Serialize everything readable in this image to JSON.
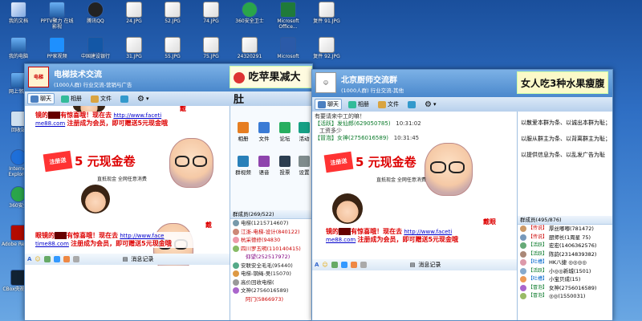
{
  "desktop": {
    "icons": [
      {
        "label": "我的文档",
        "kind": "doc"
      },
      {
        "label": "PPTV聚力 在线影视",
        "kind": "pptv"
      },
      {
        "label": "腾讯QQ",
        "kind": "qq"
      },
      {
        "label": "24.JPG",
        "kind": "img"
      },
      {
        "label": "52.JPG",
        "kind": "img"
      },
      {
        "label": "74.JPG",
        "kind": "img"
      },
      {
        "label": "360安全卫士",
        "kind": "360"
      },
      {
        "label": "Microsoft Office...",
        "kind": "xl"
      },
      {
        "label": "复件 91.JPG",
        "kind": "img"
      },
      {
        "label": "我的电脑",
        "kind": "pc"
      },
      {
        "label": "PP家视频",
        "kind": "pp"
      },
      {
        "label": "中国建设银行",
        "kind": "bank"
      },
      {
        "label": "31.JPG",
        "kind": "img"
      },
      {
        "label": "55.JPG",
        "kind": "img"
      },
      {
        "label": "75.JPG",
        "kind": "img"
      },
      {
        "label": "24320291",
        "kind": "img"
      },
      {
        "label": "Microsoft",
        "kind": "word"
      },
      {
        "label": "复件 92.JPG",
        "kind": "img"
      },
      {
        "label": "网上邻居",
        "kind": "net"
      },
      {
        "label": "回收站",
        "kind": "bin"
      },
      {
        "label": "Internet Explorer",
        "kind": "ie"
      },
      {
        "label": "360安全",
        "kind": "360"
      },
      {
        "label": "Adobe Reader",
        "kind": "pdf"
      },
      {
        "label": "CBox央视影音",
        "kind": "cbox"
      }
    ]
  },
  "left_window": {
    "title": "电梯技术交流",
    "subtitle": "(1000人群) 行业交流-营销与广告",
    "logo_text": "电梯",
    "ad_banner": "吃苹果减大肚",
    "tabs": [
      "聊天",
      "相册",
      "文件"
    ],
    "promo": {
      "top_text": "戴",
      "line1a": "镜的",
      "line1b": "有惊喜哦！现在去",
      "url1": "http://www.faceti",
      "url1b": "me88.com",
      "line1c": "注册成为会员，即可赠送5元现金哦",
      "register": "注册送",
      "cash": "5 元现金卷",
      "small": "直抵现金 全网任意消费",
      "line2a": "戴",
      "line2b": "眼镜的",
      "line2c": "有惊喜哦！现在去",
      "url2": "http://www.face",
      "url2b": "time88.com",
      "line2d": "注册成为会员，即可赠送5元现金哦"
    },
    "input_bar": {
      "history": "消息记录"
    },
    "apps": [
      {
        "label": "相册",
        "color": "#e67e22"
      },
      {
        "label": "文件",
        "color": "#3a7bd5"
      },
      {
        "label": "论坛",
        "color": "#27ae60"
      },
      {
        "label": "活动",
        "color": "#16a085"
      },
      {
        "label": "群视频",
        "color": "#2980b9"
      },
      {
        "label": "语音",
        "color": "#8e44ad"
      },
      {
        "label": "投票",
        "color": "#2c3e50"
      },
      {
        "label": "设置",
        "color": "#7f8c8d"
      }
    ],
    "members_header": "群成员(269/522)",
    "members": [
      {
        "name": "电梯(1215714607)",
        "color": "#222",
        "tag": ""
      },
      {
        "name": "江浙-电梯-设计(840122)",
        "color": "#c00",
        "tag": ""
      },
      {
        "name": "杭采德修(94830",
        "color": "#c00",
        "tag": ""
      },
      {
        "name": "四川罗五明(110140415)",
        "color": "#c00",
        "tag": ""
      },
      {
        "name": "仰望(252517972)",
        "color": "#800080",
        "tag": ""
      },
      {
        "name": "安联安全毛毛(95440)",
        "color": "#222",
        "tag": ""
      },
      {
        "name": "电梯-钢绳-吴(15070)",
        "color": "#222",
        "tag": ""
      },
      {
        "name": "高价回收电梯(",
        "color": "#222",
        "tag": ""
      },
      {
        "name": "文神(2756016589)",
        "color": "#222",
        "tag": ""
      },
      {
        "name": "阿门(5866973)",
        "color": "#c00",
        "tag": ""
      }
    ]
  },
  "right_window": {
    "title": "北京厨师交流群",
    "subtitle": "(1000人群) 行业交流-其他",
    "ad_banner": "女人吃3种水果瘦腹",
    "tabs": [
      "聊天",
      "相册",
      "文件"
    ],
    "messages": [
      {
        "user": "",
        "text": "有要请来中工的嘛！",
        "time": ""
      },
      {
        "user": "【活跃】发仙郎(629050785)",
        "text": "",
        "time": "10:31:02"
      },
      {
        "user": "",
        "text": "工资多少",
        "time": ""
      },
      {
        "user": "【冒泡】女神(2756016589)",
        "text": "",
        "time": "10:31:45"
      }
    ],
    "promo": {
      "line1a": "戴眼",
      "line1b": "镜的",
      "line1c": "有惊喜哦！现在去",
      "url1": "http://www.faceti",
      "url1b": "me88.com",
      "line1d": "注册成为会员，即可赠送5元现金哦",
      "register": "注册送",
      "cash": "5 元现金卷",
      "small": "直抵现金 全网任意消费"
    },
    "input_bar": {
      "history": "消息记录"
    },
    "notice": [
      "以散爱本群为条、以诚出本群为耻；",
      "以服从群主为条、以背离群主为耻；",
      "以提供信息为条、以乱发广告为耻"
    ],
    "members_header": "群成员(495/876)",
    "members": [
      {
        "tag": "【传说】",
        "name": "厚丝嘟嘟(781472)"
      },
      {
        "tag": "【传说】",
        "name": "厨师长(1周星 75)"
      },
      {
        "tag": "【活跃】",
        "name": "宏宏(1406362576)"
      },
      {
        "tag": "【活跃】",
        "name": "陈韵(2314839382)"
      },
      {
        "tag": "【吐槽】",
        "name": "HK八捷 ◎◎◎◎"
      },
      {
        "tag": "【活跃】",
        "name": "小◎◎新城(1501)"
      },
      {
        "tag": "【吐槽】",
        "name": "小宝贝成(15)"
      },
      {
        "tag": "【冒泡】",
        "name": "女神(2756016589)"
      },
      {
        "tag": "【冒泡】",
        "name": "◎◎(1550031)"
      }
    ]
  }
}
